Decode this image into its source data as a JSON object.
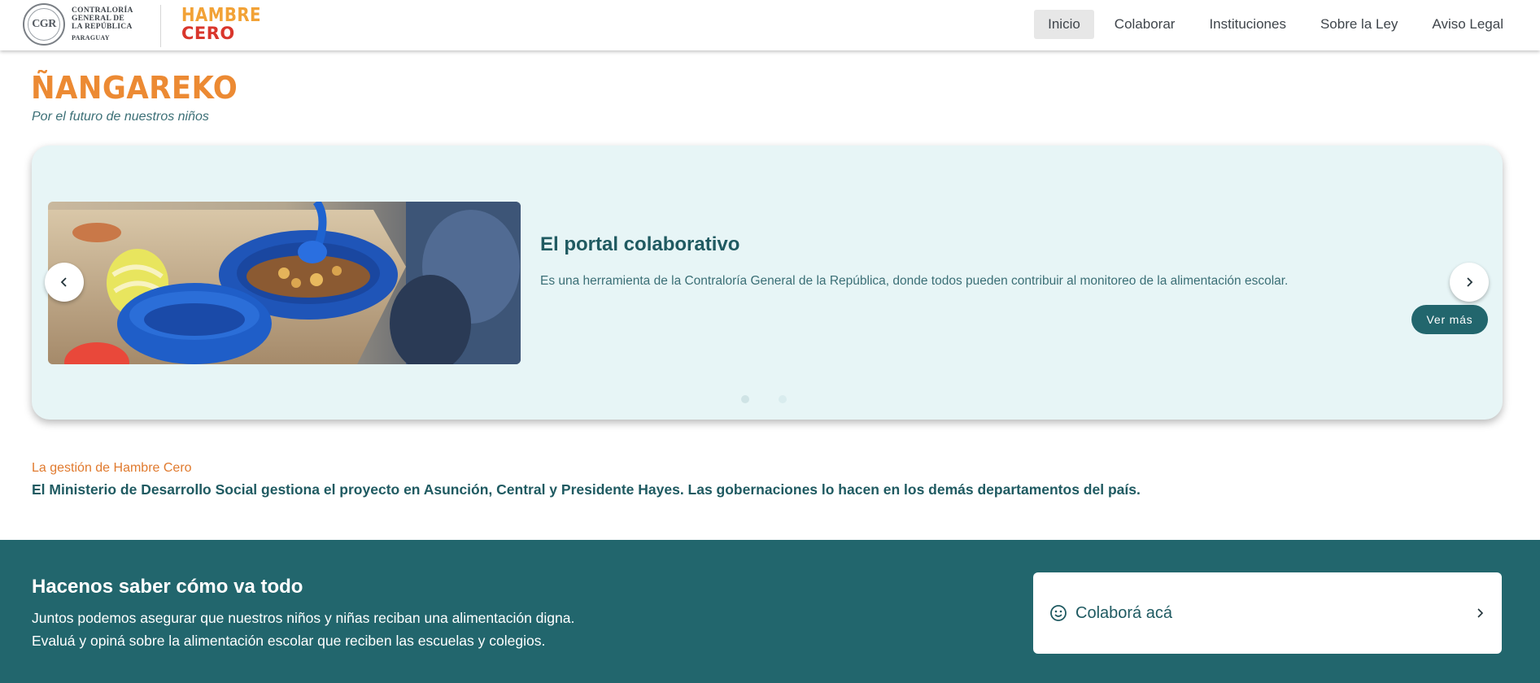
{
  "header": {
    "cgr_logo": {
      "seal_text": "CGR",
      "lines": [
        "CONTRALORÍA",
        "GENERAL DE",
        "LA REPÚBLICA"
      ],
      "country": "PARAGUAY"
    },
    "hambre_logo": {
      "line1": "HAMBRE",
      "line2": "CERO"
    },
    "nav": [
      {
        "label": "Inicio",
        "active": true
      },
      {
        "label": "Colaborar",
        "active": false
      },
      {
        "label": "Instituciones",
        "active": false
      },
      {
        "label": "Sobre la Ley",
        "active": false
      },
      {
        "label": "Aviso Legal",
        "active": false
      }
    ]
  },
  "brand": {
    "title": "ÑANGAREKO",
    "subtitle": "Por el futuro de nuestros niños"
  },
  "carousel": {
    "slide_title": "El portal colaborativo",
    "slide_description": "Es una herramienta de la Contraloría General de la República, donde todos pueden contribuir al monitoreo de la alimentación escolar.",
    "cta_label": "Ver más",
    "prev_icon": "chevron-left-icon",
    "next_icon": "chevron-right-icon",
    "slide_count": 2,
    "active_slide": 1
  },
  "gestion": {
    "label": "La gestión de Hambre Cero",
    "text": "El Ministerio de Desarrollo Social gestiona el proyecto en Asunción, Central y Presidente Hayes. Las gobernaciones lo hacen en los demás departamentos del país."
  },
  "cta_band": {
    "title": "Hacenos saber cómo va todo",
    "line1": "Juntos podemos asegurar que nuestros niños y niñas reciban una alimentación digna.",
    "line2": "Evaluá y opiná sobre la alimentación escolar que reciben las escuelas y colegios.",
    "card_label": "Colaborá acá",
    "card_icon": "smile-icon",
    "card_chevron": "chevron-right-icon"
  },
  "colors": {
    "accent_orange": "#ec8a33",
    "teal_dark": "#22666d",
    "carousel_bg": "#e7f5f6",
    "hambre_yellow": "#f2a236",
    "cero_red": "#d9362c"
  }
}
